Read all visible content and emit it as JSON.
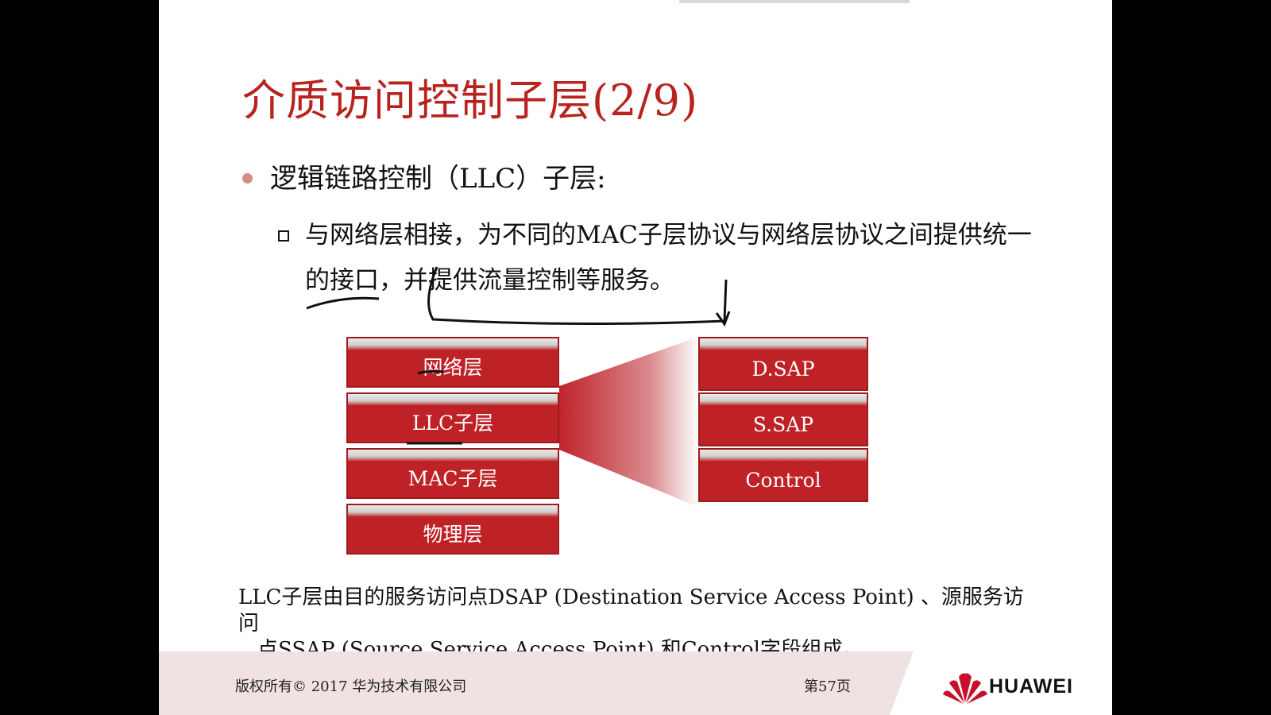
{
  "slide": {
    "title": "介质访问控制子层(2/9)",
    "bullet1": "逻辑链路控制（LLC）子层:",
    "bullet2": "与网络层相接，为不同的MAC子层协议与网络层协议之间提供统一的接口，并提供流量控制等服务。",
    "layers": [
      "网络层",
      "LLC子层",
      "MAC子层",
      "物理层"
    ],
    "fields": [
      "D.SAP",
      "S.SAP",
      "Control"
    ],
    "note_line1": "LLC子层由目的服务访问点DSAP (Destination Service Access Point) 、源服务访问",
    "note_line2": "点SSAP (Source Service Access Point) 和Control字段组成。"
  },
  "footer": {
    "copyright": "版权所有© 2017 华为技术有限公司",
    "page": "第57页",
    "brand": "HUAWEI"
  },
  "colors": {
    "title": "#b8231f",
    "block": "#bf2226",
    "footer_bg": "#f0e2e2",
    "logo": "#c8102e"
  }
}
